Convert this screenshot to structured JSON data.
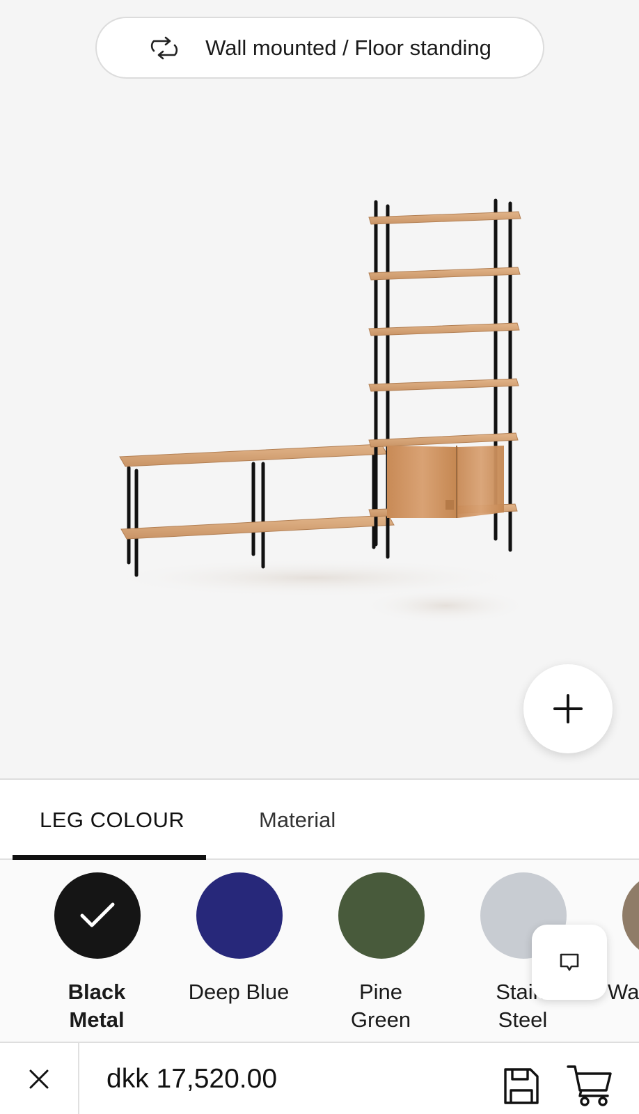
{
  "toggle": {
    "label": "Wall mounted / Floor standing",
    "icon": "swap-arrows-icon"
  },
  "viewer": {
    "add_icon": "plus-icon"
  },
  "tabs": [
    {
      "label": "LEG COLOUR",
      "active": true
    },
    {
      "label": "Material",
      "active": false
    }
  ],
  "leg_colours": [
    {
      "line1": "Black",
      "line2": "Metal",
      "color": "#151515",
      "selected": true
    },
    {
      "line1": "Deep Blue",
      "line2": "",
      "color": "#27287a",
      "selected": false
    },
    {
      "line1": "Pine",
      "line2": "Green",
      "color": "#485a3b",
      "selected": false
    },
    {
      "line1": "Stainl",
      "line2": "Steel",
      "color": "#c8ccd2",
      "selected": false
    },
    {
      "line1": "Wa",
      "line2": "",
      "color": "#8f7c68",
      "selected": false
    }
  ],
  "chat": {
    "icon": "chat-bubble-icon"
  },
  "footer": {
    "price": "dkk 17,520.00",
    "close_icon": "close-icon",
    "save_icon": "floppy-disk-icon",
    "cart_icon": "cart-icon"
  }
}
